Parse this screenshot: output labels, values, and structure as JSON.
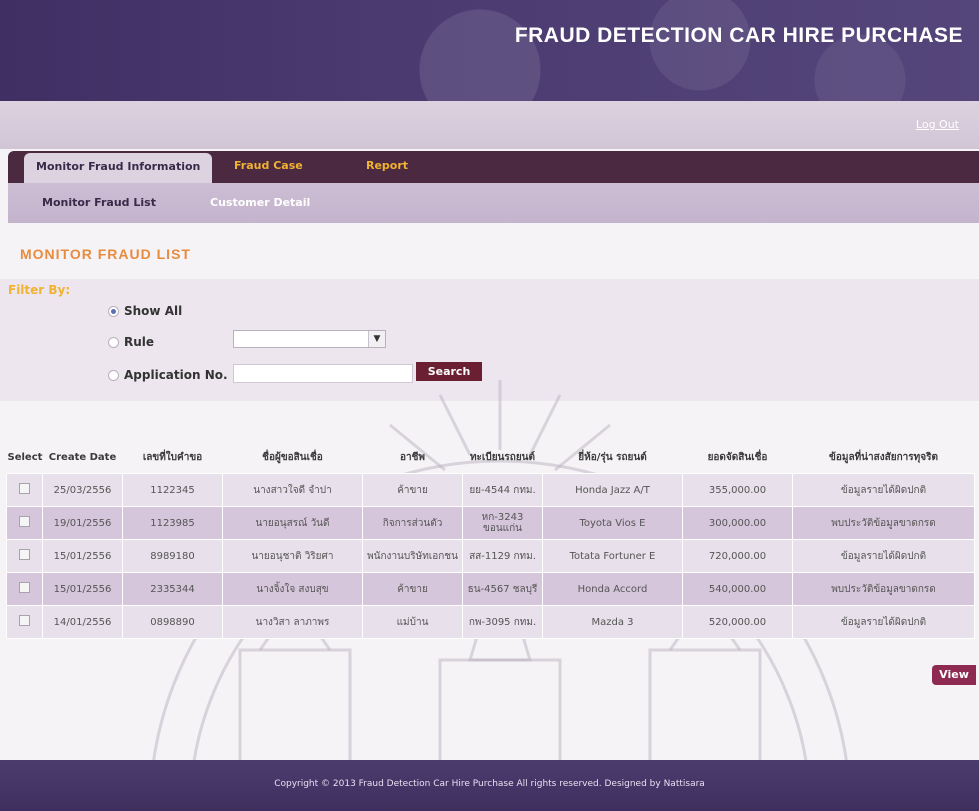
{
  "header": {
    "title": "FRAUD DETECTION CAR HIRE PURCHASE",
    "logout": "Log Out"
  },
  "tabs": [
    {
      "label": "Monitor Fraud Information",
      "active": true
    },
    {
      "label": "Fraud Case",
      "active": false
    },
    {
      "label": "Report",
      "active": false
    }
  ],
  "subnav": [
    {
      "label": "Monitor Fraud List",
      "active": true
    },
    {
      "label": "Customer Detail",
      "active": false
    }
  ],
  "page_title": "MONITOR FRAUD LIST",
  "filter": {
    "label": "Filter By:",
    "options": {
      "show_all": "Show All",
      "rule": "Rule",
      "app_no": "Application No."
    },
    "selected": "show_all",
    "rule_value": "",
    "app_no_value": "",
    "search_label": "Search"
  },
  "table": {
    "headers": [
      "Select",
      "Create Date",
      "เลขที่ใบคำขอ",
      "ชื่อผู้ขอสินเชื่อ",
      "อาชีพ",
      "ทะเบียนรถยนต์",
      "ยี่ห้อ/รุ่น รถยนต์",
      "ยอดจัดสินเชื่อ",
      "ข้อมูลที่น่าสงสัยการทุจริต"
    ],
    "rows": [
      {
        "date": "25/03/2556",
        "app_no": "1122345",
        "name": "นางสาวใจดี จำปา",
        "job": "ค้าขาย",
        "plate": "ยย-4544 กทม.",
        "car": "Honda Jazz A/T",
        "amount": "355,000.00",
        "info": "ข้อมูลรายได้ผิดปกติ"
      },
      {
        "date": "19/01/2556",
        "app_no": "1123985",
        "name": "นายอนุสรณ์ วันดี",
        "job": "กิจการส่วนตัว",
        "plate": "หก-3243 ขอนแก่น",
        "car": "Toyota Vios E",
        "amount": "300,000.00",
        "info": "พบประวัติข้อมูลขาดกรด"
      },
      {
        "date": "15/01/2556",
        "app_no": "8989180",
        "name": "นายอนุชาติ วิริยศา",
        "job": "พนักงานบริษัทเอกชน",
        "plate": "สส-1129 กทม.",
        "car": "Totata Fortuner E",
        "amount": "720,000.00",
        "info": "ข้อมูลรายได้ผิดปกติ"
      },
      {
        "date": "15/01/2556",
        "app_no": "2335344",
        "name": "นางจิ้งใจ สงบสุข",
        "job": "ค้าขาย",
        "plate": "ธน-4567 ชลบุรี",
        "car": "Honda Accord",
        "amount": "540,000.00",
        "info": "พบประวัติข้อมูลขาดกรด"
      },
      {
        "date": "14/01/2556",
        "app_no": "0898890",
        "name": "นางวิสา ลาภาพร",
        "job": "แม่บ้าน",
        "plate": "กพ-3095 กทม.",
        "car": "Mazda 3",
        "amount": "520,000.00",
        "info": "ข้อมูลรายได้ผิดปกติ"
      }
    ]
  },
  "view_label": "View",
  "footer": {
    "copyright": "Copyright © 2013 Fraud Detection Car Hire Purchase All rights reserved. Designed by Nattisara"
  },
  "colors": {
    "banner": "#433465",
    "tab_bar": "#4b2941",
    "accent_orange": "#e78b3e",
    "tab_text": "#f0b332",
    "button": "#6a1f32",
    "row_odd": "#e8e0ea",
    "row_even": "#d6c6db"
  }
}
